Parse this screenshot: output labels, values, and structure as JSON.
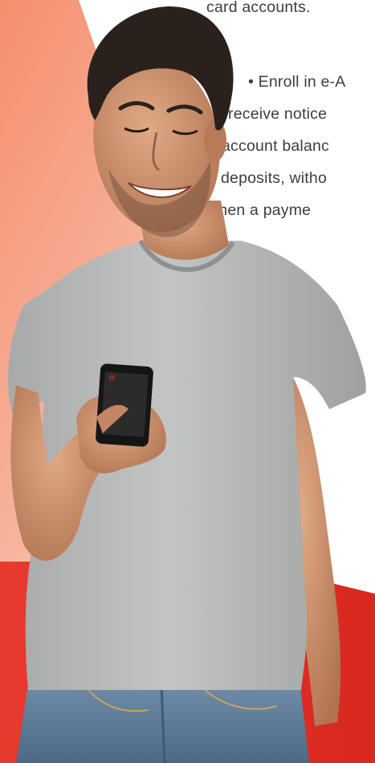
{
  "copy": {
    "line1": "card accounts.",
    "line2": "• Enroll in e-A",
    "line3": "receive notice",
    "line4": "account balanc",
    "line5": "deposits, witho",
    "line6": "when a payme"
  },
  "colors": {
    "peach": "#f6a68a",
    "peach_light": "#fbd7c8",
    "red": "#e8322a",
    "red_dark": "#c8201b",
    "shirt": "#b4b6b5",
    "skin": "#c98c68",
    "hair": "#2a211c",
    "jeans": "#5f7c98",
    "phone": "#151515"
  },
  "subject": {
    "description_icon": "man-with-phone-photo"
  }
}
